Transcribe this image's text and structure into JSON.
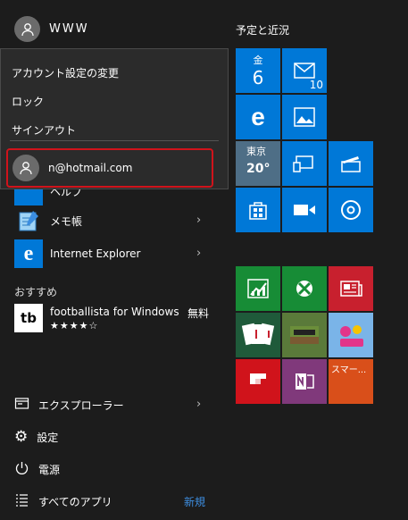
{
  "user": {
    "name": "WWW"
  },
  "account_menu": {
    "items": [
      "アカウント設定の変更",
      "ロック",
      "サインアウト"
    ],
    "other_account": "n@hotmail.com"
  },
  "apps": [
    {
      "label": "メモ帳",
      "has_submenu": true
    },
    {
      "label": "Internet Explorer",
      "has_submenu": true
    }
  ],
  "partially_hidden_label": "ヘルプ",
  "recommended": {
    "heading": "おすすめ",
    "app_name": "footballista for Windows",
    "price": "無料",
    "rating": 4
  },
  "bottom": {
    "explorer": "エクスプローラー",
    "settings": "設定",
    "power": "電源",
    "all_apps": "すべてのアプリ",
    "new_badge": "新規"
  },
  "tiles": {
    "title": "予定と近況",
    "calendar": {
      "day_name": "金",
      "day_number": "6"
    },
    "mail_count": "10",
    "weather": {
      "city": "東京",
      "temp": "20°"
    },
    "store_label": "スマー..."
  },
  "icons": [
    "user-icon",
    "notepad-icon",
    "ie-icon",
    "footballista-icon",
    "explorer-icon",
    "gear-icon",
    "power-icon",
    "all-apps-icon",
    "calendar-icon",
    "mail-icon",
    "edge-icon",
    "photos-icon",
    "weather-icon",
    "devices-icon",
    "movies-icon",
    "store-icon",
    "video-icon",
    "groove-icon",
    "money-icon",
    "xbox-icon",
    "news-icon",
    "solitaire-icon",
    "minecraft-icon",
    "candy-crush-icon",
    "flipboard-icon",
    "onenote-icon"
  ],
  "colors": {
    "tile_blue": "#0078d7",
    "tile_green": "#178c36",
    "tile_red": "#d0131b",
    "highlight_border": "#d0131b",
    "onenote_purple": "#80397b"
  }
}
